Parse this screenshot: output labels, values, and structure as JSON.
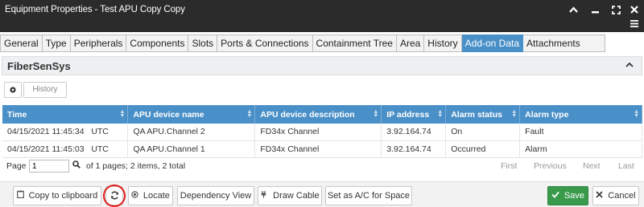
{
  "window": {
    "title": "Equipment Properties - Test APU Copy Copy"
  },
  "tabs": [
    {
      "label": "General"
    },
    {
      "label": "Type"
    },
    {
      "label": "Peripherals"
    },
    {
      "label": "Components"
    },
    {
      "label": "Slots"
    },
    {
      "label": "Ports & Connections"
    },
    {
      "label": "Containment Tree"
    },
    {
      "label": "Area"
    },
    {
      "label": "History"
    },
    {
      "label": "Add-on Data",
      "active": true
    },
    {
      "label": "Attachments"
    }
  ],
  "panel": {
    "title": "FiberSenSys",
    "history_label": "History"
  },
  "grid": {
    "columns": [
      "Time",
      "APU device name",
      "APU device description",
      "IP address",
      "Alarm status",
      "Alarm type"
    ],
    "rows": [
      [
        "04/15/2021 11:45:34   UTC",
        "QA APU.Channel 2",
        "FD34x Channel",
        "3.92.164.74",
        "On",
        "Fault"
      ],
      [
        "04/15/2021 11:45:03   UTC",
        "QA APU.Channel 1",
        "FD34x Channel",
        "3.92.164.74",
        "Occurred",
        "Alarm"
      ]
    ]
  },
  "pager": {
    "page_label": "Page",
    "page_value": "1",
    "info": "of 1 pages; 2 items, 2 total",
    "first": "First",
    "previous": "Previous",
    "next": "Next",
    "last": "Last"
  },
  "toolbar": {
    "copy_label": "Copy to clipboard",
    "locate_label": "Locate",
    "dependency_label": "Dependency View",
    "draw_cable_label": "Draw Cable",
    "set_ac_label": "Set as A/C for Space",
    "save_label": "Save",
    "cancel_label": "Cancel"
  },
  "colors": {
    "titlebar": "#2b2b2b",
    "accent": "#4a90c8",
    "save": "#3a9a4c",
    "highlight_ring": "#e01b1b"
  }
}
